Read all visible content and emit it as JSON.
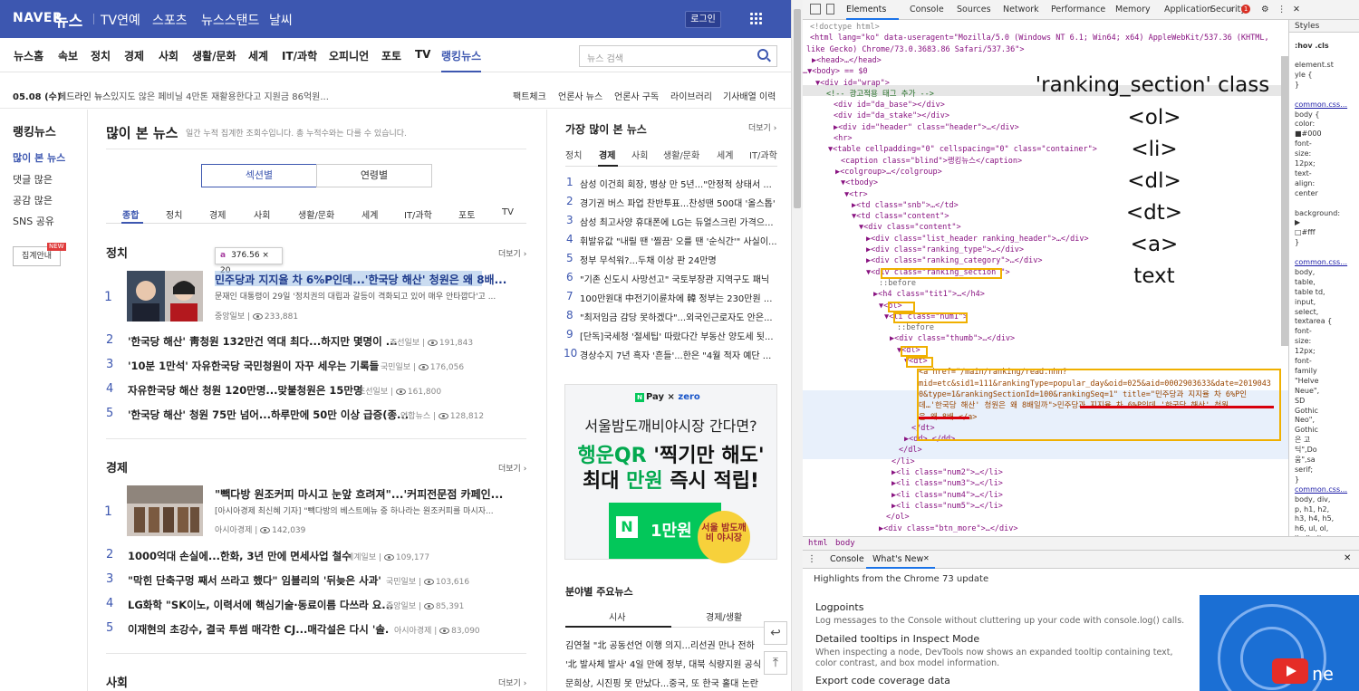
{
  "header": {
    "logo": "NAVER",
    "brand": "뉴스",
    "menus": [
      "TV연예",
      "스포츠",
      "뉴스스탠드",
      "날씨"
    ],
    "login": "로그인"
  },
  "nav": {
    "items": [
      "뉴스홈",
      "속보",
      "정치",
      "경제",
      "사회",
      "생활/문화",
      "세계",
      "IT/과학",
      "오피니언",
      "포토",
      "TV",
      "랭킹뉴스"
    ],
    "active": "랭킹뉴스",
    "search_placeholder": "뉴스 검색"
  },
  "headline": {
    "date": "05.08 (수)",
    "label": "헤드라인 뉴스",
    "text": "있지도 않은 페비닐 4만톤 재활용한다고 지원금 86억원...",
    "links": [
      "팩트체크",
      "언론사 뉴스",
      "언론사 구독",
      "라이브러리",
      "기사배열 이력"
    ]
  },
  "sidebar": {
    "title": "랭킹뉴스",
    "items": [
      "많이 본 뉴스",
      "댓글 많은",
      "공감 많은",
      "SNS 공유"
    ],
    "guide": "집계안내",
    "new_badge": "NEW"
  },
  "main": {
    "title": "많이 본 뉴스",
    "desc": "일간 누적 집계한 조회수입니다. 총 누적수와는 다를 수 있습니다.",
    "toggle": [
      "섹션별",
      "연령별"
    ],
    "tabs": [
      "종합",
      "정치",
      "경제",
      "사회",
      "생활/문화",
      "세계",
      "IT/과학",
      "포토",
      "TV"
    ],
    "more": "더보기",
    "tooltip_tag": "a",
    "tooltip_size": "376.56 × 20",
    "politics": {
      "title": "정치",
      "first": {
        "rank": "1",
        "title": "민주당과 지지율 차 6%P인데...'한국당 해산' 청원은 왜 8배...",
        "desc": "문재인 대통령이 29일 '정치권의 대립과 갈등이 격화되고 있어 매우 안타깝다'고 ...",
        "source": "중앙일보",
        "views": "233,881"
      },
      "items": [
        {
          "rank": "2",
          "title": "'한국당 해산' 靑청원 132만건 역대 최다...하지만 몇명이 ...",
          "source": "조선일보",
          "views": "191,843"
        },
        {
          "rank": "3",
          "title": "'10분 1만석' 자유한국당 국민청원이 자꾸 세우는 기록들",
          "source": "국민일보",
          "views": "176,056"
        },
        {
          "rank": "4",
          "title": "자유한국당 해산 청원 120만명...맞불청원은 15만명",
          "source": "조선일보",
          "views": "161,800"
        },
        {
          "rank": "5",
          "title": "'한국당 해산' 청원 75만 넘어...하루만에 50만 이상 급증(종...",
          "source": "연합뉴스",
          "views": "128,812"
        }
      ]
    },
    "economy": {
      "title": "경제",
      "first": {
        "rank": "1",
        "title": "\"빽다방 원조커피 마시고 눈앞 흐려져\"...'커피전문점 카페인...",
        "desc": "[아시아경제 최신혜 기자] \"빽다방의 베스트메뉴 중 하나라는 원조커피를 마시자...",
        "source": "아시아경제",
        "views": "142,039"
      },
      "items": [
        {
          "rank": "2",
          "title": "1000억대 손실에...한화, 3년 만에 면세사업 철수",
          "source": "세계일보",
          "views": "109,177"
        },
        {
          "rank": "3",
          "title": "\"막힌 단축구멍 째서 쓰라고 했다\" 임블리의 '뒤늦은 사과'",
          "source": "국민일보",
          "views": "103,616"
        },
        {
          "rank": "4",
          "title": "LG화학 \"SK이노, 이력서에 핵심기술·동료이름 다쓰라 요...",
          "source": "중앙일보",
          "views": "85,391"
        },
        {
          "rank": "5",
          "title": "이재현의 초강수, 결국 투썸 매각한 CJ...매각설은 다시 '솔...",
          "source": "아시아경제",
          "views": "83,090"
        }
      ]
    },
    "society": {
      "title": "사회"
    }
  },
  "right": {
    "title": "가장 많이 본 뉴스",
    "more": "더보기",
    "tabs": [
      "정치",
      "경제",
      "사회",
      "생활/문화",
      "세계",
      "IT/과학"
    ],
    "items": [
      {
        "rank": "1",
        "title": "삼성 이건희 회장, 병상 만 5년...\"안정적 상태서 ..."
      },
      {
        "rank": "2",
        "title": "경기권 버스 파업 찬반투표...찬성땐 500대 '올스톱'"
      },
      {
        "rank": "3",
        "title": "삼성 최고사양 휴대폰에 LG는 듀얼스크린 가격으..."
      },
      {
        "rank": "4",
        "title": "휘발유값 \"내릴 땐 '찔끔' 오를 땐 '순식간'\" 사실이..."
      },
      {
        "rank": "5",
        "title": "정부 무석워?...두채 이상 판 24만명"
      },
      {
        "rank": "6",
        "title": "\"기존 신도시 사망선고\" 국토부장관 지역구도 패닉"
      },
      {
        "rank": "7",
        "title": "100만원대 中전기이륜차에 韓 정부는 230만원 ..."
      },
      {
        "rank": "8",
        "title": "\"최저임금 감당 못하겠다\"...외국인근로자도 안은..."
      },
      {
        "rank": "9",
        "title": "[단독]국세청 '절세팁' 따랐다간 부동산 양도세 됫..."
      },
      {
        "rank": "10",
        "title": "경상수지 7년 흑자 '흔들'...한은 \"4월 적자 예단 ..."
      }
    ],
    "ad": {
      "pay": "Pay",
      "npay": "N",
      "x": "×",
      "zero": "zero",
      "l1": "서울밤도깨비야시장 간다면?",
      "l2a": "행운QR",
      "l2b": " '찍기만 해도'",
      "l3a": "최대 ",
      "l3b": "만원",
      "l3c": " 즉시 적립!",
      "n": "N",
      "won": "1만원",
      "circle": "서울 밤도깨비 야시장"
    },
    "sub": {
      "title": "분야별 주요뉴스",
      "tabs": [
        "시사",
        "경제/생활"
      ],
      "items": [
        "김연철 \"北 공동선언 이행 의지...리선권 만나 전하",
        "'北 발사체 발사' 4일 만에 정부, 대북 식량지원 공식",
        "문희상, 시진핑 못 만났다...중국, 또 한국 홀대 논란"
      ]
    }
  },
  "devtools": {
    "tabs": [
      "Elements",
      "Console",
      "Sources",
      "Network",
      "Performance",
      "Memory",
      "Application",
      "Security"
    ],
    "more": "»",
    "errors": "1",
    "lines": [
      "<!doctype html>",
      "<html lang=\"ko\" data-useragent=\"Mozilla/5.0 (Windows NT 6.1; Win64; x64) AppleWebKit/537.36 (KHTML,",
      "like Gecko) Chrome/73.0.3683.86 Safari/537.36\">",
      "▶<head>…</head>",
      "…▼<body> == $0",
      "▼<div id=\"wrap\">",
      "<!-- 광고적용 태그 추가 -->",
      "<div id=\"da_base\"></div>",
      "<div id=\"da_stake\"></div>",
      "▶<div id=\"header\" class=\"header\">…</div>",
      "<hr>",
      "▼<table cellpadding=\"0\" cellspacing=\"0\" class=\"container\">",
      "<caption class=\"blind\">랭킹뉴스</caption>",
      "▶<colgroup>…</colgroup>",
      "▼<tbody>",
      "▼<tr>",
      "▶<td class=\"snb\">…</td>",
      "▼<td class=\"content\">",
      "▼<div class=\"content\">",
      "▶<div class=\"list_header ranking_header\">…</div>",
      "▶<div class=\"ranking_type\">…</div>",
      "▶<div class=\"ranking_category\">…</div>",
      "▼<div class=\"ranking_section \">",
      "::before",
      "▶<h4 class=\"tit1\">…</h4>",
      "▼<ol>",
      "▼<li class=\"num1\">",
      "::before",
      "▶<div class=\"thumb\">…</div>",
      "▼<dl>",
      "▼<dt>",
      "<a href=\"/main/ranking/read.nhn?",
      "mid=etc&sid1=111&rankingType=popular_day&oid=025&aid=0002903633&date=2019043",
      "0&type=1&rankingSectionId=100&rankingSeq=1\" title=\"민주당과 지지율 차 6%P인",
      "데…'한국당 해산' 청원은 왜 8배일까\">민주당과 지지율 차 6%P인데…'한국당 해산' 청원",
      "은 왜 8배…</a>",
      "</dt>",
      "▶<dd>…</dd>",
      "</dl>",
      "</li>",
      "▶<li class=\"num2\">…</li>",
      "▶<li class=\"num3\">…</li>",
      "▶<li class=\"num4\">…</li>",
      "▶<li class=\"num5\">…</li>",
      "</ol>",
      "▶<div class=\"btn_more\">…</div>"
    ],
    "annotations": [
      "'ranking_section' class",
      "<ol>",
      "<li>",
      "<dl>",
      "<dt>",
      "<a>",
      "text"
    ],
    "styles_tabs": "Styles",
    "styles_filter": ":hov .cls",
    "styles": [
      "element.st",
      "yle {",
      "}",
      "",
      "common.css…",
      "body {",
      "  color:",
      "  ■#000",
      "  font-",
      "    size:",
      "    12px;",
      "  text-",
      "    align:",
      "    center",
      "",
      "background:",
      "  ▶",
      "  □#fff",
      "}",
      "",
      "common.css…",
      "body,",
      "table,",
      "table td,",
      "input,",
      "select,",
      "textarea {",
      "  font-",
      "    size:",
      "    12px;",
      "  font-",
      "    family",
      "    \"Helve",
      "    Neue\",",
      "    SD",
      "    Gothic",
      "    Neo\",",
      "    Gothic",
      "    은 고",
      "    딕\",Do",
      "    움\",sa",
      "    serif;",
      "}",
      "common.css…",
      "body, div,",
      "p, h1, h2,",
      "h3, h4, h5,",
      "h6, ul, ol,",
      "li, dl, dt"
    ],
    "breadcrumb": [
      "html",
      "body"
    ],
    "drawer_tabs": [
      "Console",
      "What's New"
    ],
    "drawer_title": "Highlights from the Chrome 73 update",
    "features": [
      {
        "h": "Logpoints",
        "p": "Log messages to the Console without cluttering up your code with console.log() calls."
      },
      {
        "h": "Detailed tooltips in Inspect Mode",
        "p": "When inspecting a node, DevTools now shows an expanded tooltip containing text,",
        "p2": "color contrast, and box model information."
      },
      {
        "h": "Export code coverage data",
        "p": ""
      }
    ],
    "c73_text": "ne"
  },
  "colors": {
    "naver_blue": "#3d57b0",
    "devtools_accent": "#1a73e8",
    "annotation_box": "#f0b000",
    "red_line": "#d8000c"
  }
}
